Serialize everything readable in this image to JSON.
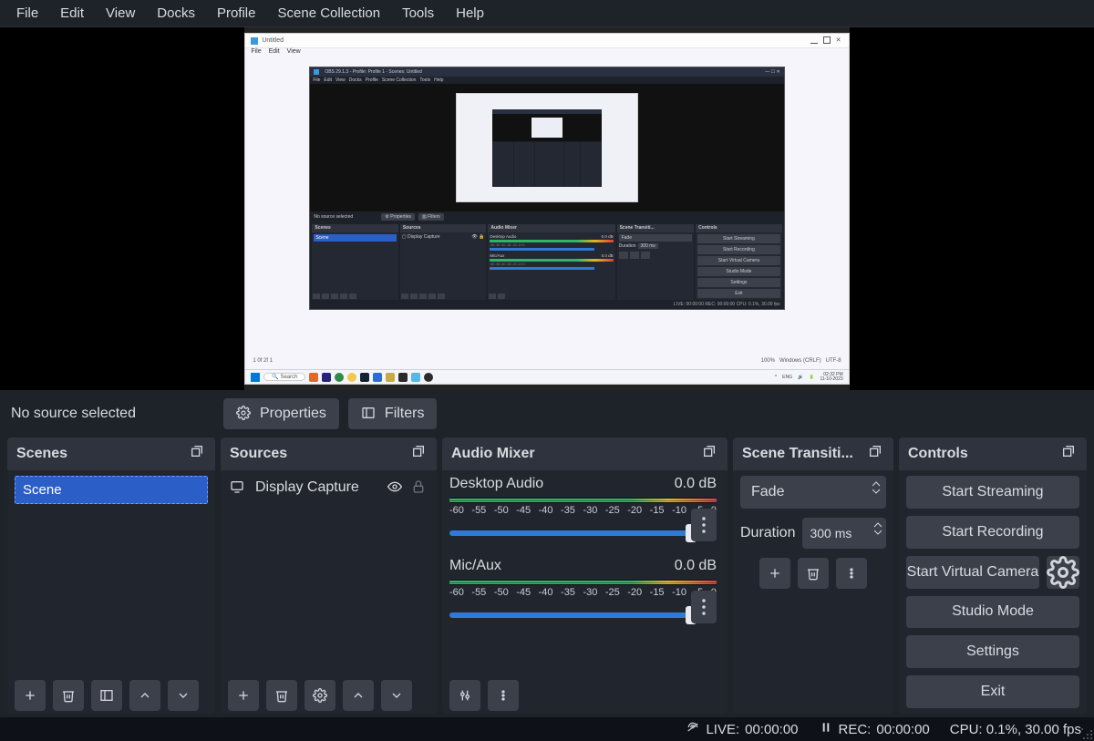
{
  "menu": [
    "File",
    "Edit",
    "View",
    "Docks",
    "Profile",
    "Scene Collection",
    "Tools",
    "Help"
  ],
  "under_preview": {
    "no_source": "No source selected",
    "properties": "Properties",
    "filters": "Filters"
  },
  "scenes": {
    "title": "Scenes",
    "items": [
      "Scene"
    ]
  },
  "sources": {
    "title": "Sources",
    "items": [
      {
        "label": "Display Capture"
      }
    ]
  },
  "audio": {
    "title": "Audio Mixer",
    "ticks": [
      "-60",
      "-55",
      "-50",
      "-45",
      "-40",
      "-35",
      "-30",
      "-25",
      "-20",
      "-15",
      "-10",
      "-5",
      "0"
    ],
    "channels": [
      {
        "name": "Desktop Audio",
        "level": "0.0 dB"
      },
      {
        "name": "Mic/Aux",
        "level": "0.0 dB"
      }
    ]
  },
  "transitions": {
    "title": "Scene Transiti...",
    "selected": "Fade",
    "duration_label": "Duration",
    "duration_value": "300 ms"
  },
  "controls": {
    "title": "Controls",
    "start_streaming": "Start Streaming",
    "start_recording": "Start Recording",
    "start_vcam": "Start Virtual Camera",
    "studio_mode": "Studio Mode",
    "settings": "Settings",
    "exit": "Exit"
  },
  "status": {
    "live_label": "LIVE:",
    "live_time": "00:00:00",
    "rec_label": "REC:",
    "rec_time": "00:00:00",
    "cpu": "CPU: 0.1%, 30.00 fps"
  },
  "preview_mock": {
    "title": "Untitled",
    "second_menu": [
      "File",
      "Edit",
      "View"
    ],
    "obs_title": "OBS 29.1.3 - Profile: Profile 1 - Scenes: Untitled",
    "obs_menu": [
      "File",
      "Edit",
      "View",
      "Docks",
      "Profile",
      "Scene Collection",
      "Tools",
      "Help"
    ],
    "no_source": "No source selected",
    "properties": "Properties",
    "filters": "Filters",
    "scenes": "Scenes",
    "scene_item": "Scene",
    "sources": "Sources",
    "source_item": "Display Capture",
    "audio": "Audio Mixer",
    "da": "Desktop Audio",
    "ma": "Mic/Aux",
    "lvl": "0.0 dB",
    "trans": "Scene Transiti...",
    "fade": "Fade",
    "dur": "Duration",
    "durv": "300 ms",
    "controls": "Controls",
    "c1": "Start Streaming",
    "c2": "Start Recording",
    "c3": "Start Virtual Camera",
    "c4": "Studio Mode",
    "c5": "Settings",
    "c6": "Exit",
    "status2": "LIVE: 00:00:00   REC: 00:00:00   CPU: 0.1%, 30.00 fps",
    "taskbar_search": "Search",
    "taskbar_time": "02:32 PM",
    "taskbar_date": "11-10-2023"
  }
}
